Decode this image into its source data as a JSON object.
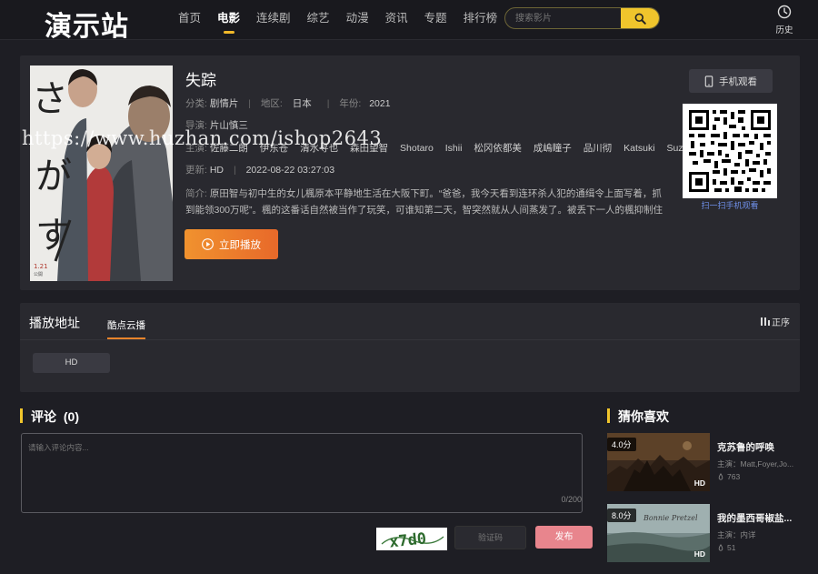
{
  "header": {
    "logo": "演示站",
    "nav": [
      "首页",
      "电影",
      "连续剧",
      "综艺",
      "动漫",
      "资讯",
      "专题",
      "排行榜"
    ],
    "search_placeholder": "搜索影片",
    "history_label": "历史"
  },
  "movie": {
    "title": "失踪",
    "category_label": "分类:",
    "category": "剧情片",
    "region_label": "地区:",
    "region": "日本",
    "year_label": "年份:",
    "year": "2021",
    "director_label": "导演:",
    "director": "片山慎三",
    "actors_label": "主演:",
    "actors": [
      "佐藤二朗",
      "伊东苍",
      "清水寻也",
      "森田望智",
      "Shotaro",
      "Ishii",
      "松冈依都美",
      "成嶋瞳子",
      "品川彻",
      "Katsuki",
      "Suzuki"
    ],
    "update_label": "更新:",
    "update_quality": "HD",
    "update_time": "2022-08-22 03:27:03",
    "intro_label": "简介:",
    "intro": "原田智与初中生的女儿楓原本平静地生活在大阪下町。“爸爸，我今天看到连环杀人犯的通缉令上面写着，抓到能领300万呢”。楓的这番话自然被当作了玩笑，可谁知第二天，智突然就从人间蒸发了。被丢下一人的楓抑制住孤独与不安，开始寻找父亲的下落。",
    "play_button": "立即播放",
    "mobile_button": "手机观看",
    "qr_caption": "扫一扫手机观看"
  },
  "playlist": {
    "title": "播放地址",
    "source_tab": "酷点云播",
    "sort_label": "正序",
    "episodes": [
      "HD"
    ]
  },
  "comments": {
    "title": "评论",
    "count_display": "(0)",
    "placeholder": "请输入评论内容...",
    "counter": "0/200",
    "captcha_text": "x7d0",
    "captcha_placeholder": "验证码",
    "submit_label": "发布"
  },
  "recommend": {
    "title": "猜你喜欢",
    "items": [
      {
        "title": "克苏鲁的呼唤",
        "score": "4.0分",
        "actor": "主演：Matt,Foyer,Jo...",
        "views": "763",
        "badge": "HD"
      },
      {
        "title": "我的墨西哥椒盐...",
        "score": "8.0分",
        "actor": "主演：内详",
        "views": "51",
        "badge": "HD"
      }
    ]
  },
  "watermark": "https://www.huzhan.com/ishop2643",
  "colors": {
    "accent": "#f0c52c",
    "play_button": "#e8692a",
    "submit": "#e8858d",
    "qr_link": "#6f8fe8"
  }
}
